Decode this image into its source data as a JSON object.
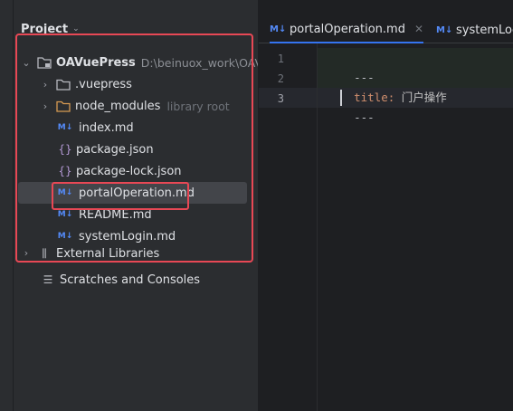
{
  "panel": {
    "title": "Project",
    "tree": [
      {
        "label": "OAVuePress",
        "extra": "D:\\beinuox_work\\OAV"
      },
      {
        "label": ".vuepress"
      },
      {
        "label": "node_modules",
        "extra": "library root"
      },
      {
        "label": "index.md",
        "icon": "M↓"
      },
      {
        "label": "package.json",
        "icon": "{}"
      },
      {
        "label": "package-lock.json",
        "icon": "{}"
      },
      {
        "label": "portalOperation.md",
        "icon": "M↓"
      },
      {
        "label": "README.md",
        "icon": "M↓"
      },
      {
        "label": "systemLogin.md",
        "icon": "M↓"
      },
      {
        "label": "External Libraries"
      },
      {
        "label": "Scratches and Consoles"
      }
    ]
  },
  "editor": {
    "tabs": [
      {
        "label": "portalOperation.md",
        "icon": "M↓",
        "close": "✕"
      },
      {
        "label": "systemLog",
        "icon": "M↓"
      }
    ],
    "line_numbers": [
      "1",
      "2",
      "3"
    ],
    "lines": {
      "l1": "---",
      "l2_key": "title:",
      "l2_val": " 门户操作",
      "l3": "---"
    }
  },
  "colors": {
    "highlight": "#e84855",
    "accent": "#3574f0",
    "md_icon": "#548af7"
  }
}
